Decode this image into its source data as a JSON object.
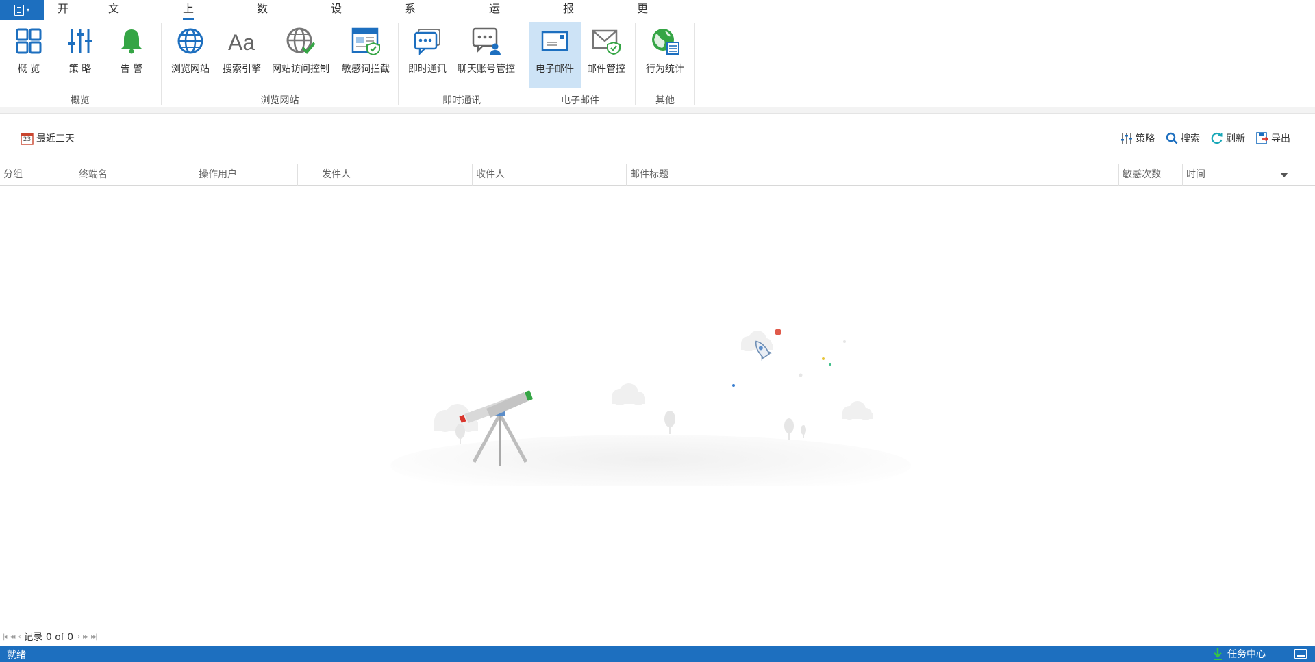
{
  "menu": {
    "tabs": [
      {
        "label": "开始"
      },
      {
        "label": "文档加密"
      },
      {
        "label": "上网行为",
        "active": true
      },
      {
        "label": "数据安全"
      },
      {
        "label": "设备管理"
      },
      {
        "label": "系统&网络"
      },
      {
        "label": "运维中心"
      },
      {
        "label": "报表中心"
      },
      {
        "label": "更多功能"
      }
    ]
  },
  "ribbon": {
    "groups": [
      {
        "label": "概览",
        "items": [
          {
            "label": "概 览",
            "icon": "grid-icon"
          },
          {
            "label": "策 略",
            "icon": "sliders-icon"
          },
          {
            "label": "告 警",
            "icon": "bell-icon"
          }
        ]
      },
      {
        "label": "浏览网站",
        "items": [
          {
            "label": "浏览网站",
            "icon": "globe-icon"
          },
          {
            "label": "搜索引擎",
            "icon": "font-aa-icon"
          },
          {
            "label": "网站访问控制",
            "icon": "globe-check-icon"
          },
          {
            "label": "敏感词拦截",
            "icon": "webpage-shield-icon"
          }
        ]
      },
      {
        "label": "即时通讯",
        "items": [
          {
            "label": "即时通讯",
            "icon": "chat-bubble-icon"
          },
          {
            "label": "聊天账号管控",
            "icon": "chat-user-icon"
          }
        ]
      },
      {
        "label": "电子邮件",
        "items": [
          {
            "label": "电子邮件",
            "icon": "envelope-icon",
            "selected": true
          },
          {
            "label": "邮件管控",
            "icon": "envelope-shield-icon"
          }
        ]
      },
      {
        "label": "其他",
        "items": [
          {
            "label": "行为统计",
            "icon": "globe-stats-icon"
          }
        ]
      }
    ]
  },
  "toolbar": {
    "date_range": "最近三天",
    "calendar_day": "23",
    "policy": "策略",
    "search": "搜索",
    "refresh": "刷新",
    "export": "导出"
  },
  "table": {
    "columns": [
      "分组",
      "终端名",
      "操作用户",
      "",
      "发件人",
      "收件人",
      "邮件标题",
      "敏感次数",
      "时间"
    ],
    "rows": []
  },
  "pager": {
    "record_text": "记录 0 of 0"
  },
  "status": {
    "text": "就绪",
    "task_center": "任务中心"
  },
  "colors": {
    "accent": "#1d6fbf",
    "selected_bg": "#cde3f6",
    "status_bar": "#1d6fbf"
  }
}
